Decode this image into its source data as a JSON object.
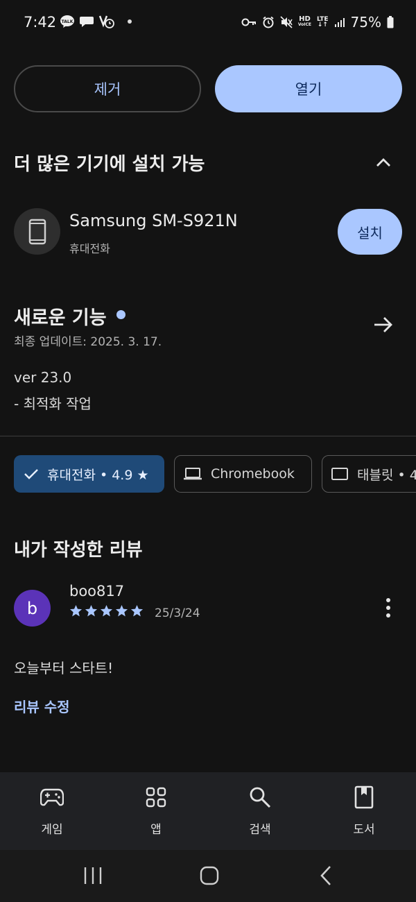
{
  "status_bar": {
    "time": "7:42",
    "battery": "75%"
  },
  "top_actions": {
    "remove_label": "제거",
    "open_label": "열기"
  },
  "more_devices": {
    "title": "더 많은 기기에 설치 가능",
    "device": {
      "name": "Samsung SM-S921N",
      "type": "휴대전화",
      "install_label": "설치"
    }
  },
  "whats_new": {
    "title": "새로운 기능",
    "last_updated": "최종 업데이트: 2025. 3. 17.",
    "version": "ver 23.0",
    "note": "- 최적화 작업"
  },
  "device_chips": [
    {
      "label": "휴대전화 • 4.9 ★",
      "selected": true,
      "icon": "check-icon"
    },
    {
      "label": "Chromebook",
      "selected": false,
      "icon": "laptop-icon"
    },
    {
      "label": "태블릿 • 4",
      "selected": false,
      "icon": "tablet-icon"
    }
  ],
  "my_review": {
    "title": "내가 작성한 리뷰",
    "avatar_letter": "b",
    "reviewer": "boo817",
    "rating": 5,
    "date": "25/3/24",
    "text": "오늘부터 스타트!",
    "edit_label": "리뷰 수정"
  },
  "bottom_nav": [
    {
      "label": "게임",
      "icon": "gamepad-icon"
    },
    {
      "label": "앱",
      "icon": "apps-grid-icon"
    },
    {
      "label": "검색",
      "icon": "search-icon"
    },
    {
      "label": "도서",
      "icon": "book-icon"
    }
  ],
  "colors": {
    "background": "#131313",
    "accent": "#aac7ff",
    "chip_selected": "#1f4a78",
    "avatar": "#5b33b8"
  }
}
